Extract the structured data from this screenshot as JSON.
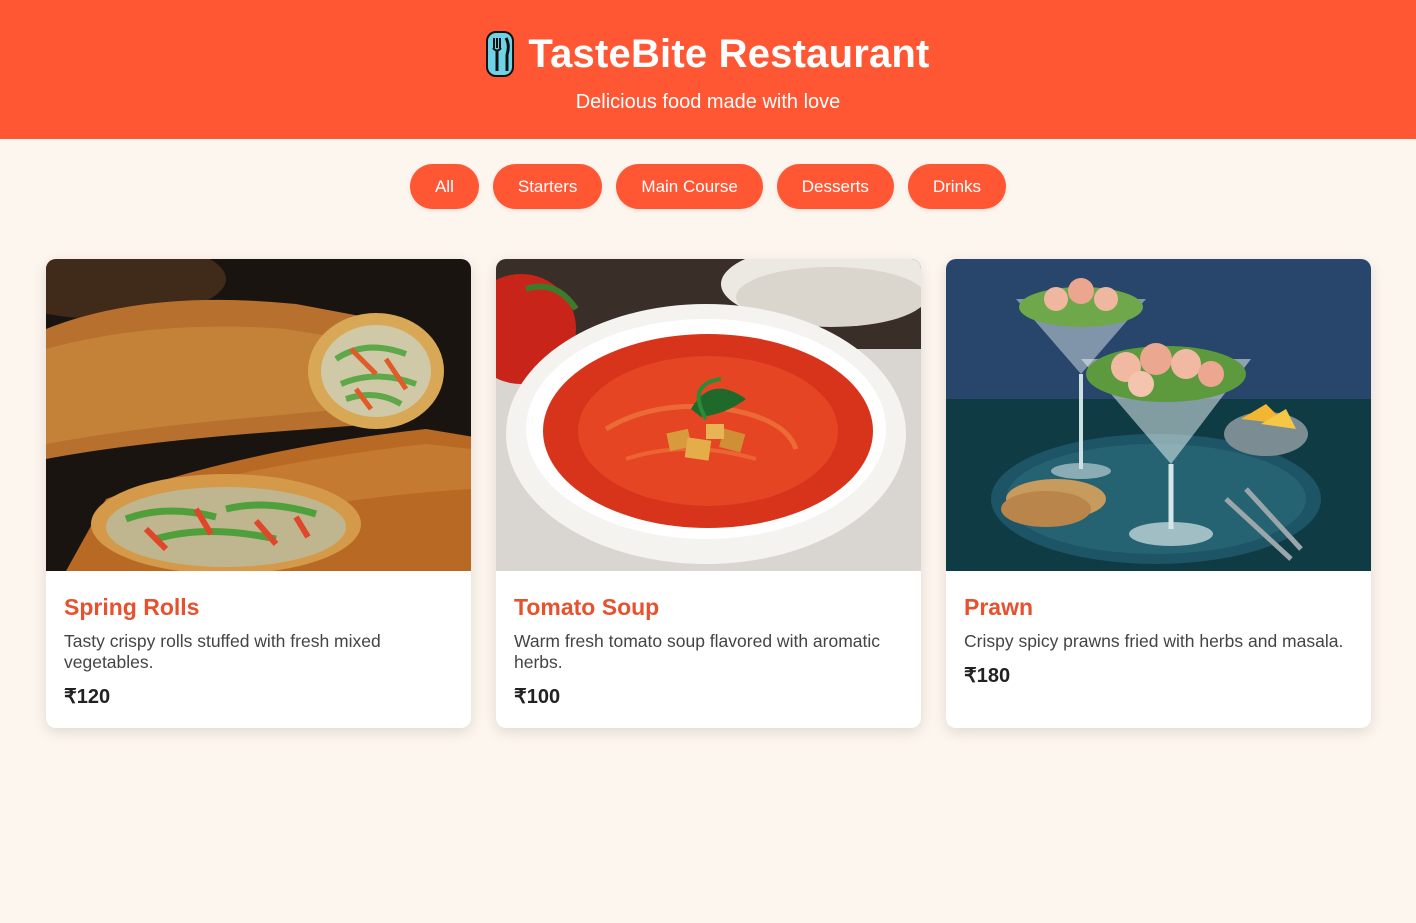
{
  "header": {
    "title": "TasteBite Restaurant",
    "subtitle": "Delicious food made with love",
    "logo_icon": "fork-knife-icon",
    "background": "#ff5733"
  },
  "filters": [
    {
      "label": "All"
    },
    {
      "label": "Starters"
    },
    {
      "label": "Main Course"
    },
    {
      "label": "Desserts"
    },
    {
      "label": "Drinks"
    }
  ],
  "menu": [
    {
      "name": "Spring Rolls",
      "description": "Tasty crispy rolls stuffed with fresh mixed vegetables.",
      "price": "₹120",
      "image": "spring-rolls-photo"
    },
    {
      "name": "Tomato Soup",
      "description": "Warm fresh tomato soup flavored with aromatic herbs.",
      "price": "₹100",
      "image": "tomato-soup-photo"
    },
    {
      "name": "Prawn",
      "description": "Crispy spicy prawns fried with herbs and masala.",
      "price": "₹180",
      "image": "prawn-cocktail-photo"
    }
  ],
  "colors": {
    "accent": "#ff5733",
    "item_name": "#e8512e",
    "page_background": "#fdf6ee"
  }
}
